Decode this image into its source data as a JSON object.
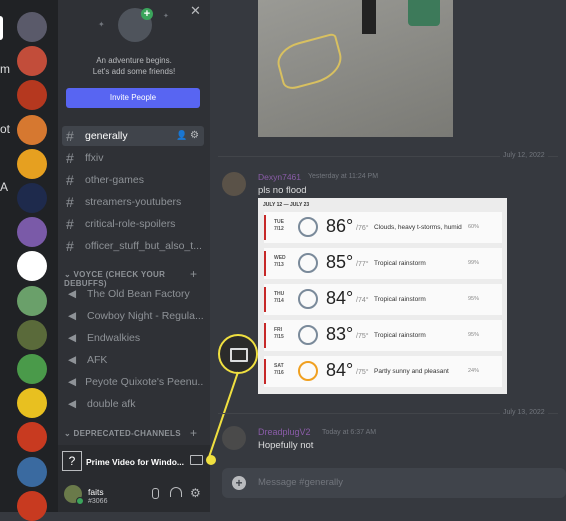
{
  "servers": [
    {
      "color": "#5a5a6a"
    },
    {
      "color": "#c24d3a"
    },
    {
      "color": "#b5381f"
    },
    {
      "color": "#d67830"
    },
    {
      "color": "#e6a020"
    },
    {
      "color": "#1e2a4c"
    },
    {
      "color": "#7a5aa8"
    },
    {
      "color": "#ffffff"
    },
    {
      "color": "#6aa06a"
    },
    {
      "color": "#5a6a3a"
    },
    {
      "color": "#4a9a4a"
    },
    {
      "color": "#e8c020"
    },
    {
      "color": "#c83a20"
    },
    {
      "color": "#3a6aa0"
    },
    {
      "color": "#c83a20"
    }
  ],
  "edge_text": [
    "m",
    "ot",
    "A"
  ],
  "welcome": {
    "line1": "An adventure begins.",
    "line2": "Let's add some friends!",
    "invite_label": "Invite People"
  },
  "text_channels": [
    {
      "name": "generally",
      "active": true
    },
    {
      "name": "ffxiv"
    },
    {
      "name": "other-games"
    },
    {
      "name": "streamers-youtubers"
    },
    {
      "name": "critical-role-spoilers"
    },
    {
      "name": "officer_stuff_but_also_t..."
    }
  ],
  "voice_category": "VOYCE (CHECK YOUR DEBUFFS)",
  "voice_channels": [
    "The Old Bean Factory",
    "Cowboy Night - Regula...",
    "Endwalkies",
    "AFK",
    "Peyote Quixote's Peenu...",
    "double afk"
  ],
  "deprecated_category": "DEPRECATED-CHANNELS",
  "activity": {
    "label": "Prime Video for Windo...",
    "icon_text": "?"
  },
  "user": {
    "name": "faits",
    "tag": "#3066"
  },
  "dates": {
    "d1": "July 12, 2022",
    "d2": "July 13, 2022"
  },
  "message1": {
    "author": "Dexyn7461",
    "time": "Yesterday at 11:24 PM",
    "text": "pls no flood"
  },
  "weather": {
    "header": "JULY 12 — JULY 23",
    "days": [
      {
        "day": "TUE",
        "date": "7/12",
        "temp": "86°",
        "low": "/76°",
        "desc": "Clouds, heavy t-storms, humid",
        "pct": "60%",
        "icon": "storm-icon"
      },
      {
        "day": "WED",
        "date": "7/13",
        "temp": "85°",
        "low": "/77°",
        "desc": "Tropical rainstorm",
        "pct": "99%",
        "icon": "rain-icon"
      },
      {
        "day": "THU",
        "date": "7/14",
        "temp": "84°",
        "low": "/74°",
        "desc": "Tropical rainstorm",
        "pct": "95%",
        "icon": "rain-icon"
      },
      {
        "day": "FRI",
        "date": "7/15",
        "temp": "83°",
        "low": "/75°",
        "desc": "Tropical rainstorm",
        "pct": "95%",
        "icon": "rain-icon"
      },
      {
        "day": "SAT",
        "date": "7/16",
        "temp": "84°",
        "low": "/75°",
        "desc": "Partly sunny and pleasant",
        "pct": "24%",
        "icon": "partly-sunny-icon"
      }
    ]
  },
  "message2": {
    "author": "DreadplugV2",
    "time": "Today at 6:37 AM",
    "text": "Hopefully not"
  },
  "composer": {
    "placeholder": "Message #generally"
  },
  "colors": {
    "callout": "#f0e040",
    "blurple": "#5865f2"
  }
}
